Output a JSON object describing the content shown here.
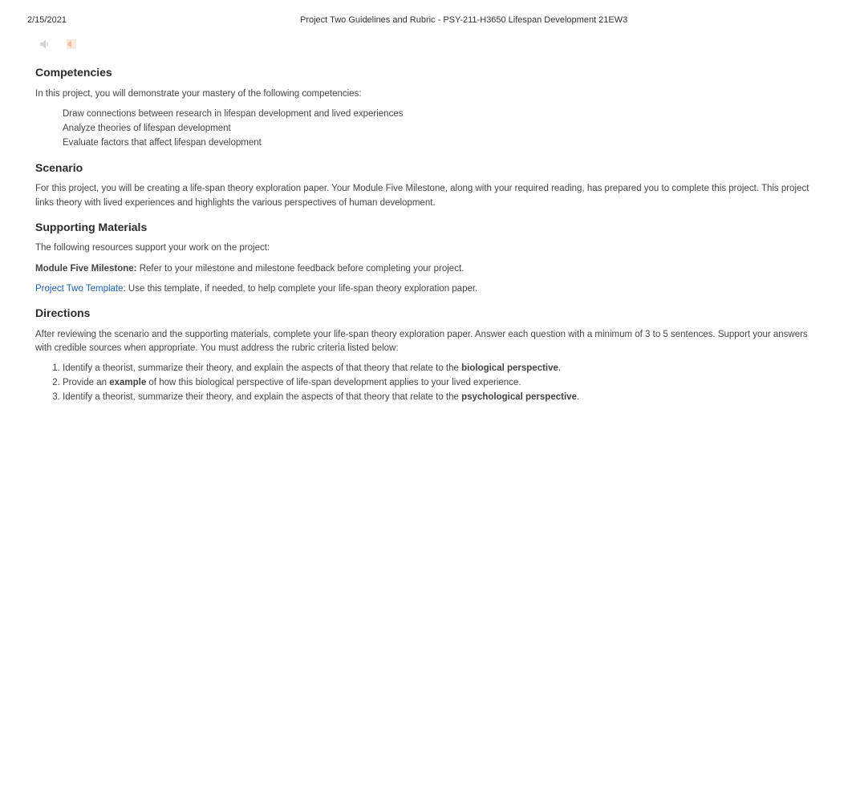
{
  "header": {
    "date": "2/15/2021",
    "title": "Project Two Guidelines and Rubric - PSY-211-H3650 Lifespan Development 21EW3"
  },
  "sections": {
    "competencies": {
      "heading": "Competencies",
      "intro": "In this project, you will demonstrate your mastery of the following competencies:",
      "items": [
        "Draw connections between research in lifespan development and lived experiences",
        "Analyze theories of lifespan development",
        "Evaluate factors that affect lifespan development"
      ]
    },
    "scenario": {
      "heading": "Scenario",
      "body": "For this project, you will be creating a life-span theory exploration paper. Your Module Five Milestone, along with your required reading, has prepared you to complete this project. This project links theory with lived experiences and highlights the various perspectives of human development."
    },
    "supporting": {
      "heading": "Supporting Materials",
      "intro": "The following resources support your work on the project:",
      "line1_bold": "Module Five Milestone:",
      "line1_rest": " Refer to your milestone and milestone feedback before completing your project.",
      "line2_link": "Project Two Template",
      "line2_rest": ": Use this template, if needed, to help complete your life-span theory exploration paper."
    },
    "directions": {
      "heading": "Directions",
      "intro": "After reviewing the scenario and the supporting materials, complete your life-span theory exploration paper. Answer each question with a minimum of 3 to 5 sentences. Support your answers with credible sources when appropriate. You must address the rubric criteria listed below:",
      "items": [
        {
          "pre": "Identify a theorist, summarize their theory, and explain the aspects of that theory that relate to the ",
          "bold": "biological perspective",
          "post": "."
        },
        {
          "pre": "Provide an ",
          "bold": "example",
          "post": " of how this biological perspective of life-span development applies to your lived experience."
        },
        {
          "pre": "Identify a theorist, summarize their theory, and explain the aspects of that theory that relate to the ",
          "bold": "psychological perspective",
          "post": "."
        }
      ]
    }
  }
}
